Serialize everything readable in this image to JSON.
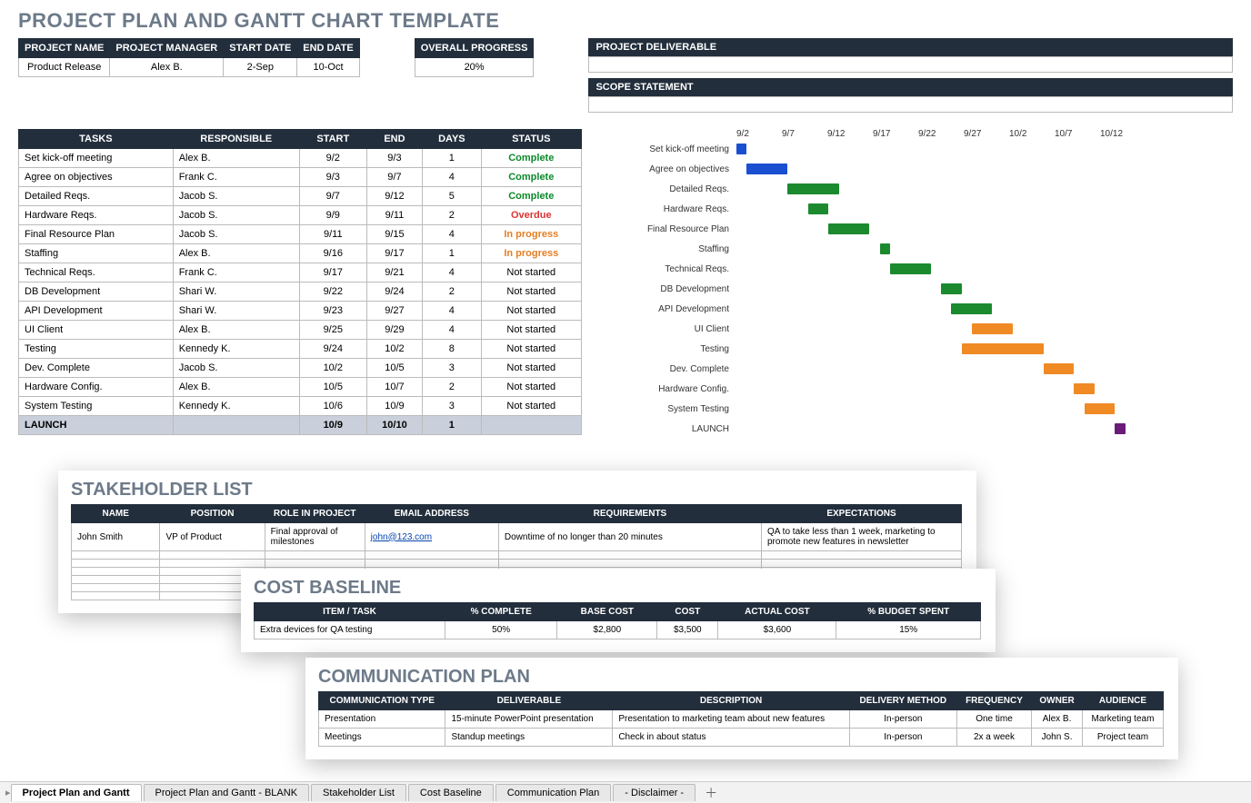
{
  "title": "PROJECT PLAN AND GANTT CHART TEMPLATE",
  "info": {
    "headers": [
      "PROJECT NAME",
      "PROJECT MANAGER",
      "START DATE",
      "END DATE"
    ],
    "values": [
      "Product Release",
      "Alex B.",
      "2-Sep",
      "10-Oct"
    ]
  },
  "progress": {
    "header": "OVERALL PROGRESS",
    "value": "20%"
  },
  "deliv_header": "PROJECT DELIVERABLE",
  "scope_header": "SCOPE STATEMENT",
  "task_headers": [
    "TASKS",
    "RESPONSIBLE",
    "START",
    "END",
    "DAYS",
    "STATUS"
  ],
  "tasks": [
    {
      "t": "Set kick-off meeting",
      "r": "Alex B.",
      "s": "9/2",
      "e": "9/3",
      "d": "1",
      "st": "Complete",
      "cls": "status-complete"
    },
    {
      "t": "Agree on objectives",
      "r": "Frank C.",
      "s": "9/3",
      "e": "9/7",
      "d": "4",
      "st": "Complete",
      "cls": "status-complete"
    },
    {
      "t": "Detailed Reqs.",
      "r": "Jacob S.",
      "s": "9/7",
      "e": "9/12",
      "d": "5",
      "st": "Complete",
      "cls": "status-complete"
    },
    {
      "t": "Hardware Reqs.",
      "r": "Jacob S.",
      "s": "9/9",
      "e": "9/11",
      "d": "2",
      "st": "Overdue",
      "cls": "status-overdue"
    },
    {
      "t": "Final Resource Plan",
      "r": "Jacob S.",
      "s": "9/11",
      "e": "9/15",
      "d": "4",
      "st": "In progress",
      "cls": "status-inprog"
    },
    {
      "t": "Staffing",
      "r": "Alex B.",
      "s": "9/16",
      "e": "9/17",
      "d": "1",
      "st": "In progress",
      "cls": "status-inprog"
    },
    {
      "t": "Technical Reqs.",
      "r": "Frank C.",
      "s": "9/17",
      "e": "9/21",
      "d": "4",
      "st": "Not started",
      "cls": ""
    },
    {
      "t": "DB Development",
      "r": "Shari W.",
      "s": "9/22",
      "e": "9/24",
      "d": "2",
      "st": "Not started",
      "cls": ""
    },
    {
      "t": "API Development",
      "r": "Shari W.",
      "s": "9/23",
      "e": "9/27",
      "d": "4",
      "st": "Not started",
      "cls": ""
    },
    {
      "t": "UI Client",
      "r": "Alex B.",
      "s": "9/25",
      "e": "9/29",
      "d": "4",
      "st": "Not started",
      "cls": ""
    },
    {
      "t": "Testing",
      "r": "Kennedy K.",
      "s": "9/24",
      "e": "10/2",
      "d": "8",
      "st": "Not started",
      "cls": ""
    },
    {
      "t": "Dev. Complete",
      "r": "Jacob S.",
      "s": "10/2",
      "e": "10/5",
      "d": "3",
      "st": "Not started",
      "cls": ""
    },
    {
      "t": "Hardware Config.",
      "r": "Alex B.",
      "s": "10/5",
      "e": "10/7",
      "d": "2",
      "st": "Not started",
      "cls": ""
    },
    {
      "t": "System Testing",
      "r": "Kennedy K.",
      "s": "10/6",
      "e": "10/9",
      "d": "3",
      "st": "Not started",
      "cls": ""
    }
  ],
  "launch": {
    "t": "LAUNCH",
    "s": "10/9",
    "e": "10/10",
    "d": "1"
  },
  "chart_data": {
    "type": "gantt",
    "x_ticks": [
      "9/2",
      "9/7",
      "9/12",
      "9/17",
      "9/22",
      "9/27",
      "10/2",
      "10/7",
      "10/12"
    ],
    "x_range": [
      0,
      40
    ],
    "rows": [
      {
        "label": "Set kick-off meeting",
        "start": 0,
        "dur": 1,
        "color": "blue"
      },
      {
        "label": "Agree on objectives",
        "start": 1,
        "dur": 4,
        "color": "blue"
      },
      {
        "label": "Detailed Reqs.",
        "start": 5,
        "dur": 5,
        "color": "green"
      },
      {
        "label": "Hardware Reqs.",
        "start": 7,
        "dur": 2,
        "color": "green"
      },
      {
        "label": "Final Resource Plan",
        "start": 9,
        "dur": 4,
        "color": "green"
      },
      {
        "label": "Staffing",
        "start": 14,
        "dur": 1,
        "color": "green"
      },
      {
        "label": "Technical Reqs.",
        "start": 15,
        "dur": 4,
        "color": "green"
      },
      {
        "label": "DB Development",
        "start": 20,
        "dur": 2,
        "color": "green"
      },
      {
        "label": "API Development",
        "start": 21,
        "dur": 4,
        "color": "green"
      },
      {
        "label": "UI Client",
        "start": 23,
        "dur": 4,
        "color": "orange"
      },
      {
        "label": "Testing",
        "start": 22,
        "dur": 8,
        "color": "orange"
      },
      {
        "label": "Dev. Complete",
        "start": 30,
        "dur": 3,
        "color": "orange"
      },
      {
        "label": "Hardware Config.",
        "start": 33,
        "dur": 2,
        "color": "orange"
      },
      {
        "label": "System Testing",
        "start": 34,
        "dur": 3,
        "color": "orange"
      },
      {
        "label": "LAUNCH",
        "start": 37,
        "dur": 1,
        "color": "purple"
      }
    ]
  },
  "stake": {
    "title": "STAKEHOLDER LIST",
    "headers": [
      "NAME",
      "POSITION",
      "ROLE IN PROJECT",
      "EMAIL ADDRESS",
      "REQUIREMENTS",
      "EXPECTATIONS"
    ],
    "row": {
      "name": "John Smith",
      "pos": "VP of Product",
      "role": "Final approval of milestones",
      "email": "john@123.com",
      "req": "Downtime of no longer than 20 minutes",
      "exp": "QA to take less than 1 week, marketing to promote new features in newsletter"
    }
  },
  "cost": {
    "title": "COST BASELINE",
    "headers": [
      "ITEM / TASK",
      "% COMPLETE",
      "BASE COST",
      "COST",
      "ACTUAL COST",
      "% BUDGET SPENT"
    ],
    "row": [
      "Extra devices for QA testing",
      "50%",
      "$2,800",
      "$3,500",
      "$3,600",
      "15%"
    ]
  },
  "comm": {
    "title": "COMMUNICATION PLAN",
    "headers": [
      "COMMUNICATION TYPE",
      "DELIVERABLE",
      "DESCRIPTION",
      "DELIVERY METHOD",
      "FREQUENCY",
      "OWNER",
      "AUDIENCE"
    ],
    "rows": [
      [
        "Presentation",
        "15-minute PowerPoint presentation",
        "Presentation to marketing team about new features",
        "In-person",
        "One time",
        "Alex B.",
        "Marketing team"
      ],
      [
        "Meetings",
        "Standup meetings",
        "Check in about status",
        "In-person",
        "2x a week",
        "John S.",
        "Project team"
      ]
    ]
  },
  "tabs": [
    "Project Plan and Gantt",
    "Project Plan and Gantt - BLANK",
    "Stakeholder List",
    "Cost Baseline",
    "Communication Plan",
    "- Disclaimer -"
  ]
}
